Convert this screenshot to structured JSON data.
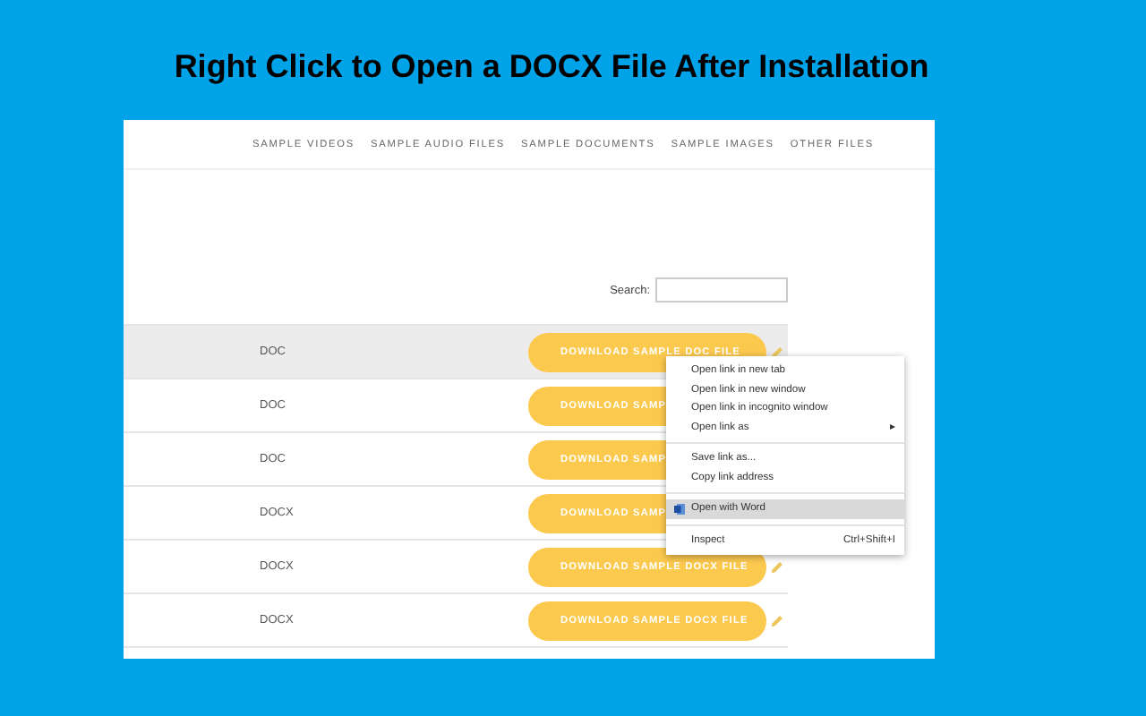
{
  "headline": "Right Click to Open a DOCX File After Installation",
  "nav": [
    "SAMPLE VIDEOS",
    "SAMPLE AUDIO FILES",
    "SAMPLE DOCUMENTS",
    "SAMPLE IMAGES",
    "OTHER FILES"
  ],
  "search": {
    "label": "Search:"
  },
  "rows": [
    {
      "type": "DOC",
      "button": "DOWNLOAD SAMPLE DOC FILE",
      "selected": true,
      "edit_icon": true
    },
    {
      "type": "DOC",
      "button": "DOWNLOAD SAMP",
      "selected": false,
      "edit_icon": false
    },
    {
      "type": "DOC",
      "button": "DOWNLOAD SAMP",
      "selected": false,
      "edit_icon": false
    },
    {
      "type": "DOCX",
      "button": "DOWNLOAD SAMP",
      "selected": false,
      "edit_icon": false
    },
    {
      "type": "DOCX",
      "button": "DOWNLOAD SAMPLE DOCX FILE",
      "selected": false,
      "edit_icon": true
    },
    {
      "type": "DOCX",
      "button": "DOWNLOAD SAMPLE DOCX FILE",
      "selected": false,
      "edit_icon": true
    }
  ],
  "context_menu": {
    "groups": [
      [
        {
          "kind": "plain",
          "label": "Open link in new tab",
          "selected": false
        },
        {
          "kind": "plain",
          "label": "Open link in new window",
          "selected": false
        },
        {
          "kind": "plain",
          "label": "Open link in incognito window",
          "selected": false
        },
        {
          "kind": "plain",
          "label": "Open link as",
          "selected": false,
          "submenu": "▸"
        }
      ],
      [
        {
          "kind": "plain",
          "label": "Save link as...",
          "selected": false
        },
        {
          "kind": "plain",
          "label": "Copy link address",
          "selected": false
        }
      ],
      [
        {
          "kind": "app",
          "label": "Open with Word",
          "selected": true
        }
      ],
      [
        {
          "kind": "plain",
          "label": "Inspect",
          "selected": false,
          "shortcut": "Ctrl+Shift+I"
        }
      ]
    ]
  }
}
